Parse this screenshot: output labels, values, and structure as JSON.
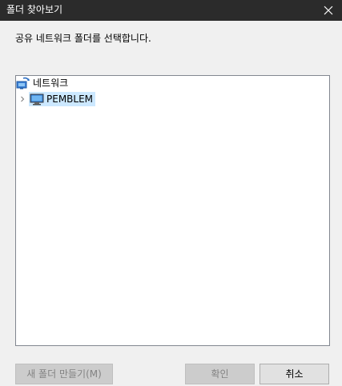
{
  "window": {
    "title": "폴더 찾아보기",
    "close_icon": "close-icon"
  },
  "instruction": "공유 네트워크 폴더를 선택합니다.",
  "tree": {
    "root": {
      "label": "네트워크",
      "icon": "network-icon"
    },
    "children": [
      {
        "label": "PEMBLEM",
        "icon": "computer-icon",
        "expander": "chevron-right-icon",
        "selected": true
      }
    ]
  },
  "buttons": {
    "new_folder": "새 폴더 만들기(M)",
    "ok": "확인",
    "cancel": "취소"
  },
  "colors": {
    "titlebar": "#2b2b2b",
    "dialog_bg": "#f0f0f0",
    "selection": "#cce8ff",
    "disabled_button": "#cccccc",
    "button": "#e1e1e1"
  }
}
